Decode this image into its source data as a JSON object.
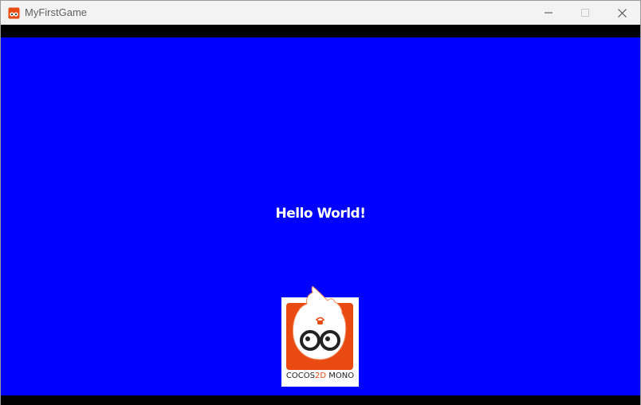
{
  "window": {
    "title": "MyFirstGame",
    "buttons": {
      "minimize": "minimize-icon",
      "maximize": "maximize-icon",
      "close": "close-icon"
    }
  },
  "game": {
    "background_color": "#0000ff",
    "message": "Hello World!",
    "logo": {
      "text_part1": "COCOS",
      "text_part2": "2D",
      "text_part3": " MONO",
      "accent_color": "#e84a12"
    }
  }
}
